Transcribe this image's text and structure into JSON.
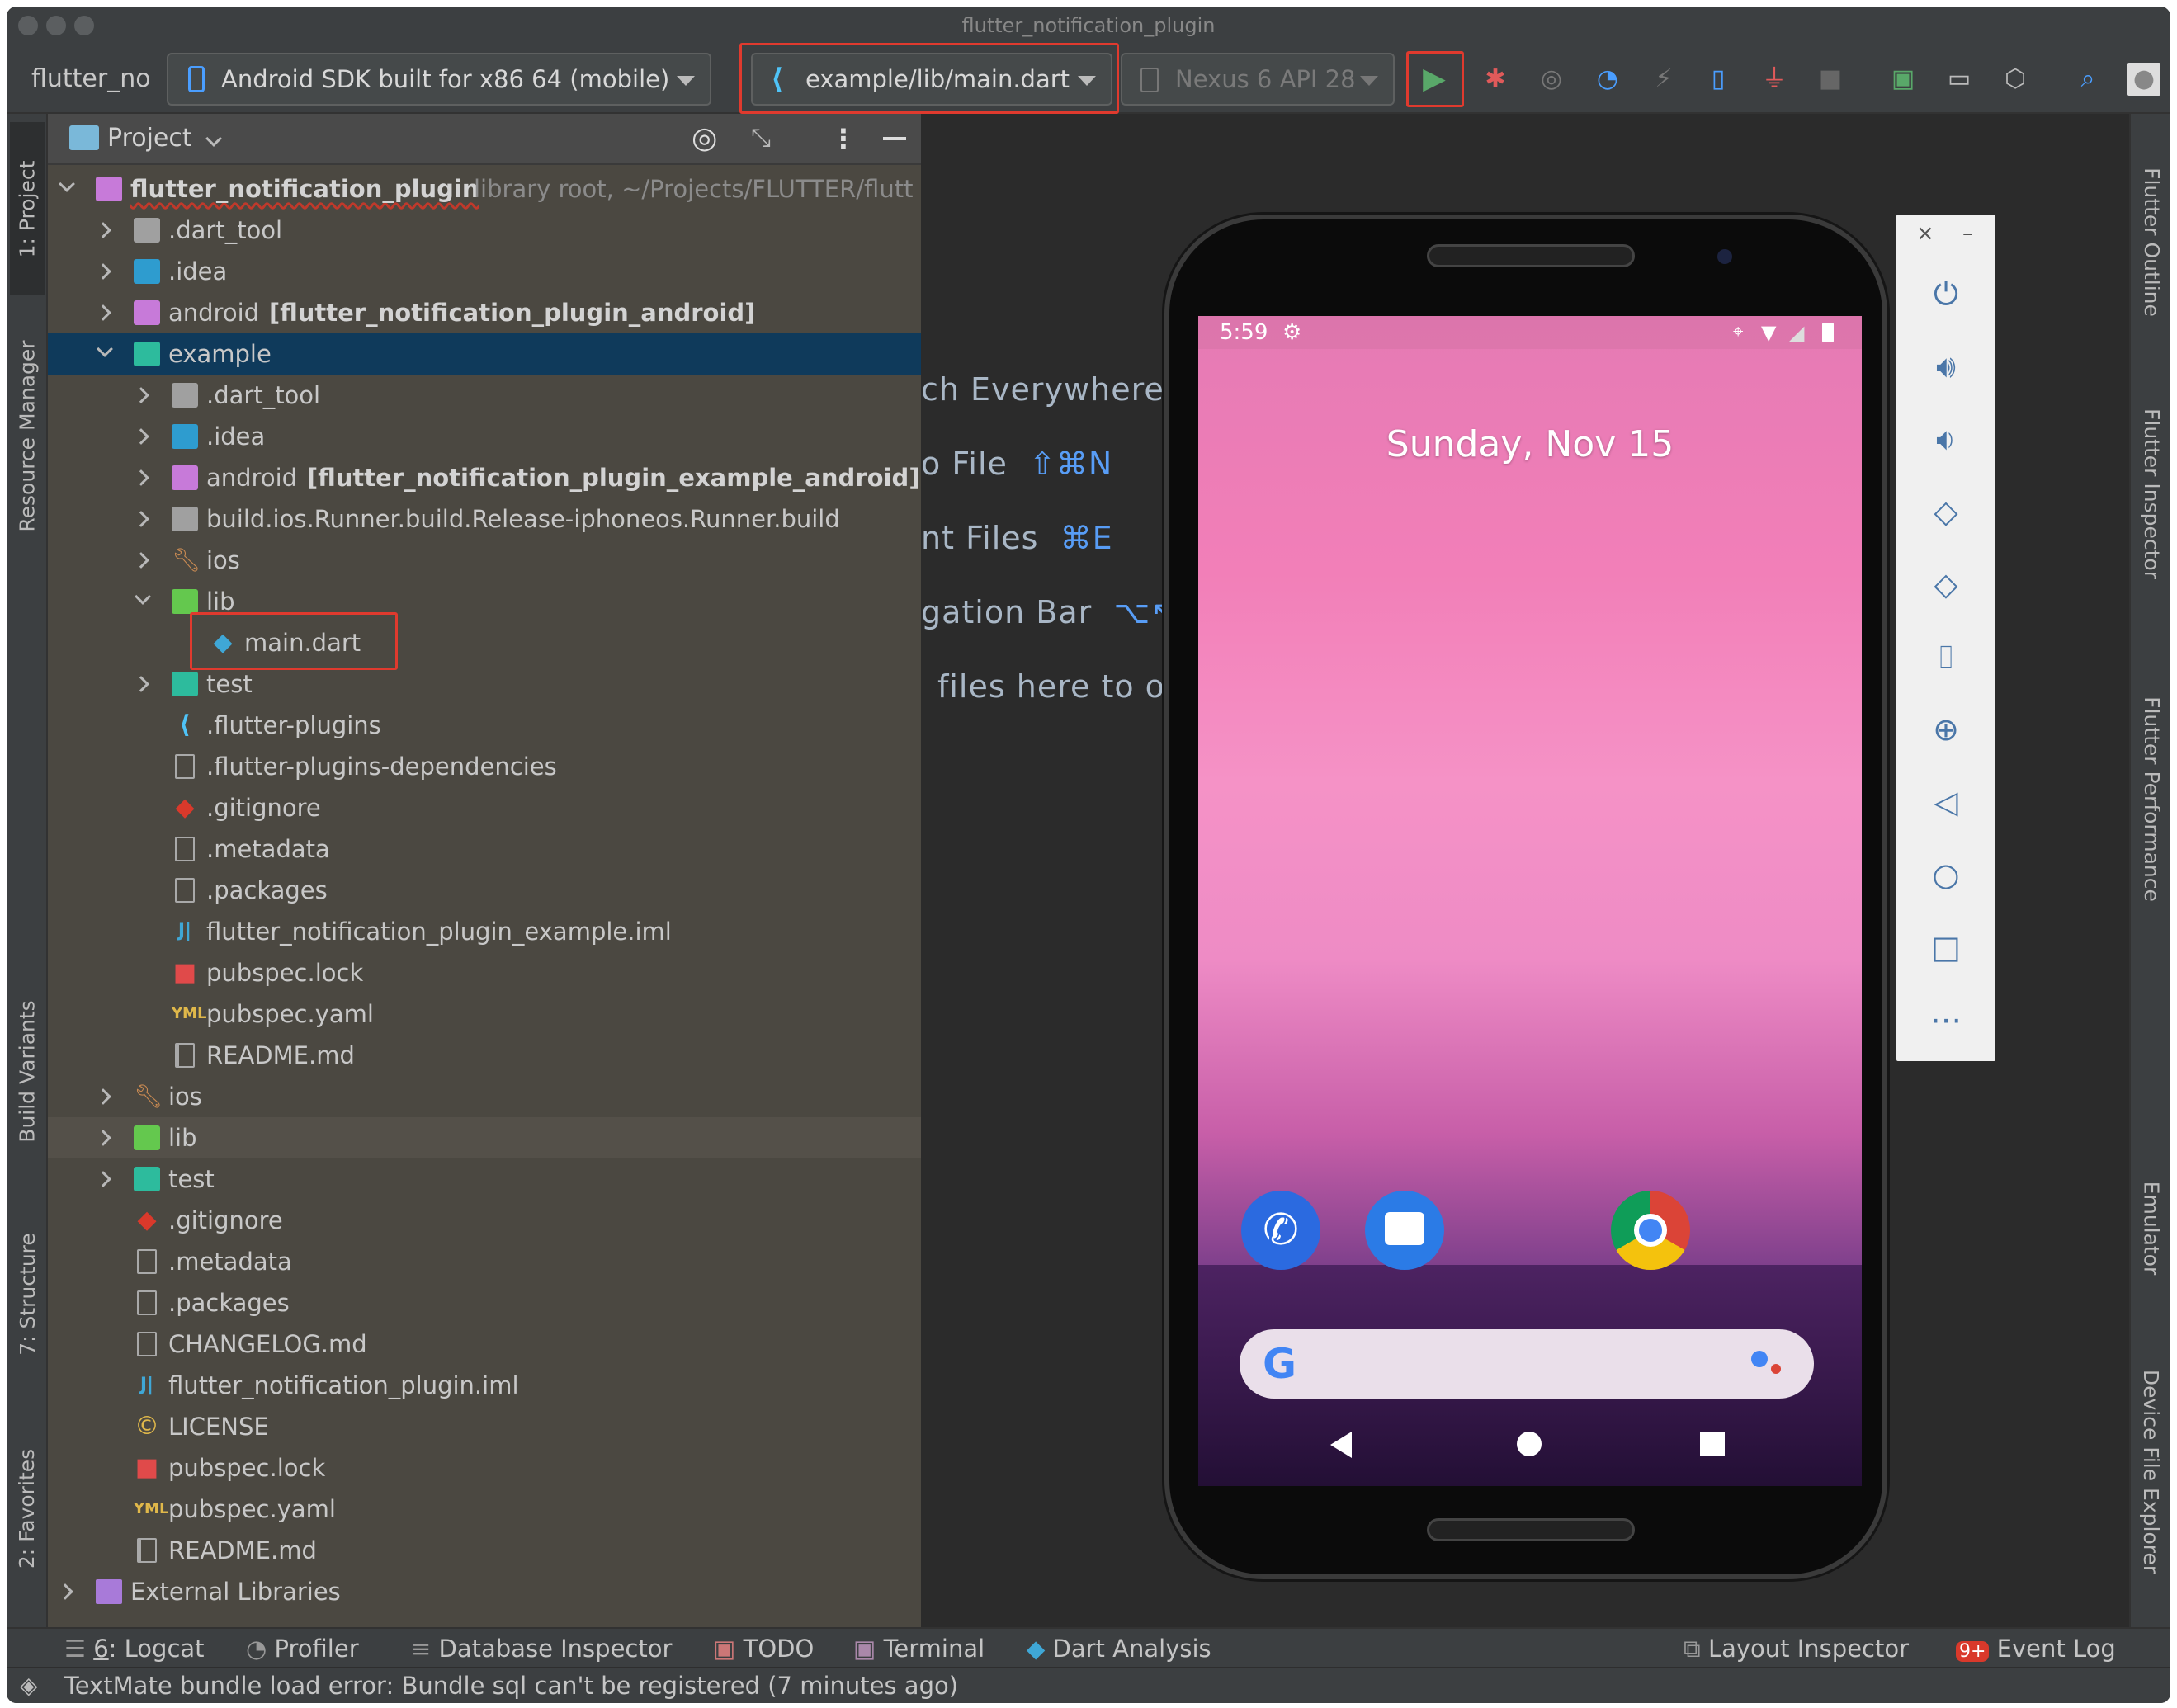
{
  "window": {
    "title": "flutter_notification_plugin"
  },
  "toolbar": {
    "project_name": "flutter_no",
    "device_selector": "Android SDK built for x86 64 (mobile)",
    "run_config": "example/lib/main.dart",
    "avd_selector": "Nexus 6 API 28"
  },
  "project_panel": {
    "view_label": "Project",
    "tree": [
      {
        "name": "flutter_notification_plugin",
        "suffix": "library root,  ~/Projects/FLUTTER/flutt"
      },
      {
        "name": ".dart_tool"
      },
      {
        "name": ".idea"
      },
      {
        "name": "android",
        "module": "[flutter_notification_plugin_android]"
      },
      {
        "name": "example"
      },
      {
        "name": ".dart_tool"
      },
      {
        "name": ".idea"
      },
      {
        "name": "android",
        "module": "[flutter_notification_plugin_example_android]"
      },
      {
        "name": "build.ios.Runner.build.Release-iphoneos.Runner.build"
      },
      {
        "name": "ios"
      },
      {
        "name": "lib"
      },
      {
        "name": "main.dart"
      },
      {
        "name": "test"
      },
      {
        "name": ".flutter-plugins"
      },
      {
        "name": ".flutter-plugins-dependencies"
      },
      {
        "name": ".gitignore"
      },
      {
        "name": ".metadata"
      },
      {
        "name": ".packages"
      },
      {
        "name": "flutter_notification_plugin_example.iml"
      },
      {
        "name": "pubspec.lock"
      },
      {
        "name": "pubspec.yaml"
      },
      {
        "name": "README.md"
      },
      {
        "name": "ios"
      },
      {
        "name": "lib"
      },
      {
        "name": "test"
      },
      {
        "name": ".gitignore"
      },
      {
        "name": ".metadata"
      },
      {
        "name": ".packages"
      },
      {
        "name": "CHANGELOG.md"
      },
      {
        "name": "flutter_notification_plugin.iml"
      },
      {
        "name": "LICENSE"
      },
      {
        "name": "pubspec.lock"
      },
      {
        "name": "pubspec.yaml"
      },
      {
        "name": "README.md"
      },
      {
        "name": "External Libraries"
      }
    ]
  },
  "editor_hints": [
    {
      "text": "ch Everywhere",
      "key": ""
    },
    {
      "text": "o File",
      "key": "⇧⌘N"
    },
    {
      "text": "nt Files",
      "key": "⌘E"
    },
    {
      "text": "gation Bar",
      "key": "⌥↖"
    },
    {
      "text": "files here to o",
      "key": ""
    }
  ],
  "left_tabs": [
    "1: Project",
    "Resource Manager",
    "Build Variants",
    "7: Structure",
    "2: Favorites"
  ],
  "right_tabs": [
    "Flutter Outline",
    "Flutter Inspector",
    "Flutter Performance",
    "Emulator",
    "Device File Explorer"
  ],
  "phone": {
    "time": "5:59",
    "date": "Sunday, Nov 15"
  },
  "emulator_panel": {
    "close": "×",
    "minimize": "–"
  },
  "bottom_tools": {
    "logcat_num": "6",
    "logcat": ": Logcat",
    "profiler": "Profiler",
    "database": "Database Inspector",
    "todo": "TODO",
    "terminal": "Terminal",
    "dart_analysis": "Dart Analysis",
    "layout_inspector": "Layout Inspector",
    "event_log_badge": "9+",
    "event_log": "Event Log"
  },
  "status": {
    "message": "TextMate bundle load error: Bundle sql can't be registered (7 minutes ago)"
  },
  "colors": {
    "accent_red": "#e03a2e",
    "selection": "#0f3a5b",
    "run_green": "#59a869"
  }
}
